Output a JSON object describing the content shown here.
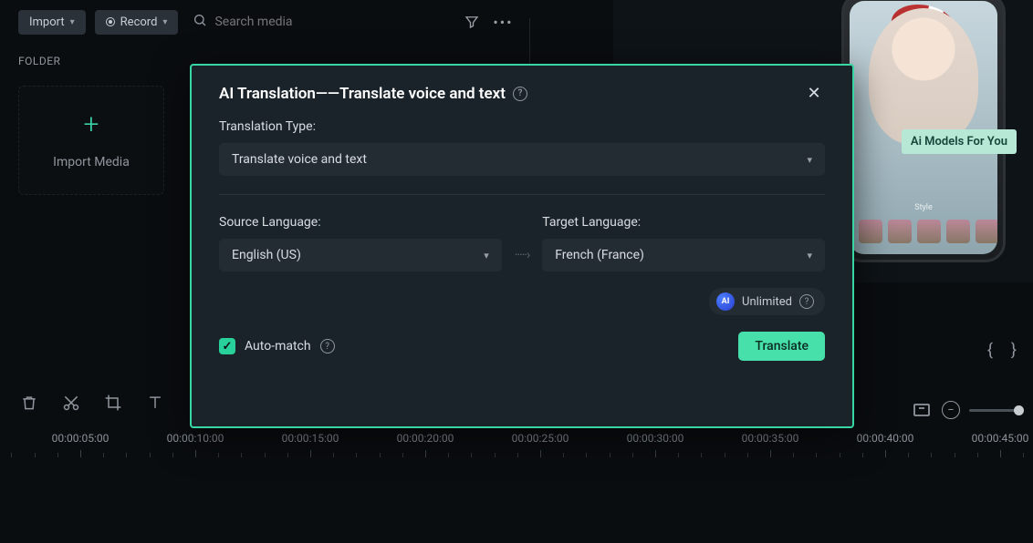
{
  "toolbar": {
    "import_label": "Import",
    "record_label": "Record",
    "search_placeholder": "Search media"
  },
  "sidebar": {
    "folder_label": "FOLDER",
    "import_tile_label": "Import Media"
  },
  "preview": {
    "overlay_text": "Ai Models For You"
  },
  "modal": {
    "title": "AI Translation——Translate voice and text",
    "type_label": "Translation Type:",
    "type_value": "Translate voice and text",
    "source_label": "Source Language:",
    "source_value": "English (US)",
    "target_label": "Target Language:",
    "target_value": "French (France)",
    "unlimited_label": "Unlimited",
    "ai_badge": "AI",
    "automatch_label": "Auto-match",
    "translate_button": "Translate"
  },
  "braces": {
    "open": "{",
    "close": "}"
  },
  "timeline": {
    "labels": [
      "00:00:05:00",
      "00:00:10:00",
      "00:00:15:00",
      "00:00:20:00",
      "00:00:25:00",
      "00:00:30:00",
      "00:00:35:00",
      "00:00:40:00",
      "00:00:45:00"
    ]
  }
}
